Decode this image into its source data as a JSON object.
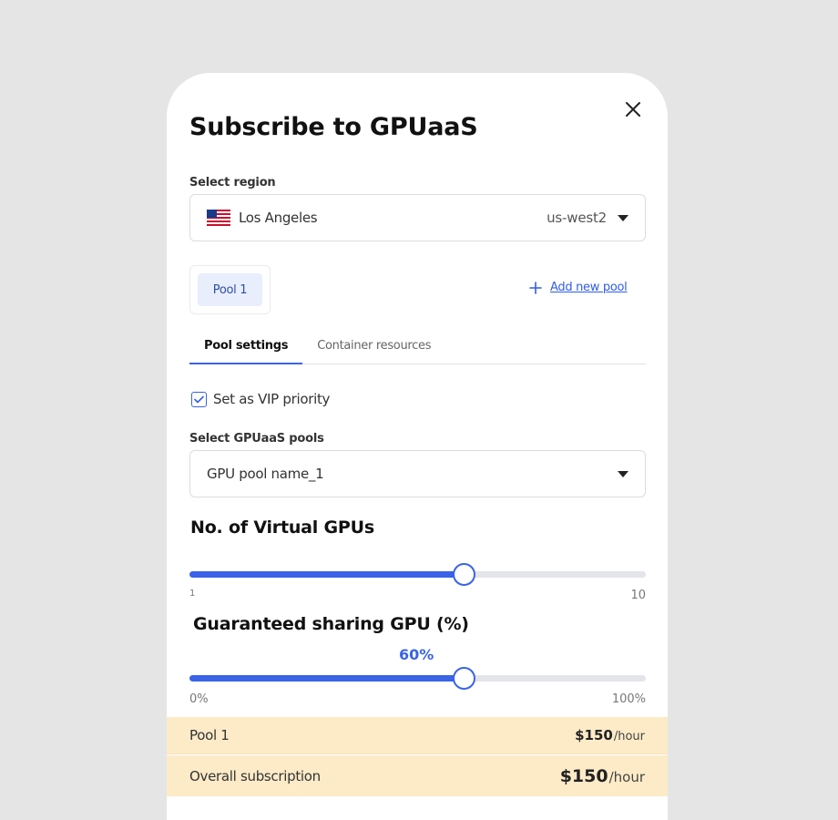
{
  "modal": {
    "title": "Subscribe to GPUaaS"
  },
  "region": {
    "label": "Select region",
    "city": "Los Angeles",
    "code": "us-west2",
    "flag_icon": "us-flag-icon"
  },
  "pools": {
    "active_pool": "Pool 1",
    "add_label": "Add new pool"
  },
  "tabs": [
    {
      "label": "Pool settings",
      "active": true
    },
    {
      "label": "Container resources",
      "active": false
    }
  ],
  "vip": {
    "label": "Set as VIP priority",
    "checked": true
  },
  "gpu_pool": {
    "label": "Select GPUaaS pools",
    "value": "GPU pool name_1"
  },
  "virtual_gpus": {
    "heading": "No. of Virtual GPUs",
    "min_label": "1",
    "max_label": "10",
    "fill_fraction": 0.6
  },
  "sharing": {
    "heading": "Guaranteed sharing GPU (%)",
    "value_label": "60%",
    "min_label": "0%",
    "max_label": "100%",
    "value": 60
  },
  "summary": {
    "pool_label": "Pool 1",
    "pool_price": "$150",
    "pool_unit": "/hour",
    "overall_label": "Overall subscription",
    "overall_price": "$150",
    "overall_unit": "/hour"
  },
  "colors": {
    "accent": "#3a63e8",
    "summary_bg": "#fdebc8",
    "chip_bg": "#e8eefc"
  }
}
